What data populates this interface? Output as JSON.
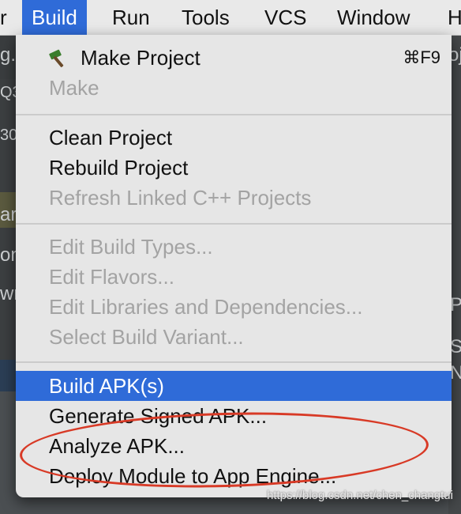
{
  "menubar": {
    "partial_left": "r",
    "items": [
      "Build",
      "Run",
      "Tools",
      "VCS",
      "Window"
    ],
    "partial_right": "H"
  },
  "background_fragments": [
    "g.",
    "Q3",
    "30",
    "ar",
    "on",
    "wn",
    "oj",
    "P",
    "S",
    "N"
  ],
  "menu": {
    "make_project": {
      "label": "Make Project",
      "shortcut": "⌘F9"
    },
    "make": "Make",
    "clean_project": "Clean Project",
    "rebuild_project": "Rebuild Project",
    "refresh_cpp": "Refresh Linked C++ Projects",
    "edit_build_types": "Edit Build Types...",
    "edit_flavors": "Edit Flavors...",
    "edit_libraries": "Edit Libraries and Dependencies...",
    "select_variant": "Select Build Variant...",
    "build_apk": "Build APK(s)",
    "generate_signed": "Generate Signed APK...",
    "analyze_apk": "Analyze APK...",
    "deploy_module": "Deploy Module to App Engine..."
  },
  "watermark": "https://blog.csdn.net/chen_changtui",
  "colors": {
    "highlight": "#2f6bd8",
    "annotation": "#d83a26",
    "disabled": "#a3a3a3"
  },
  "icons": {
    "make_project": "hammer-icon"
  }
}
